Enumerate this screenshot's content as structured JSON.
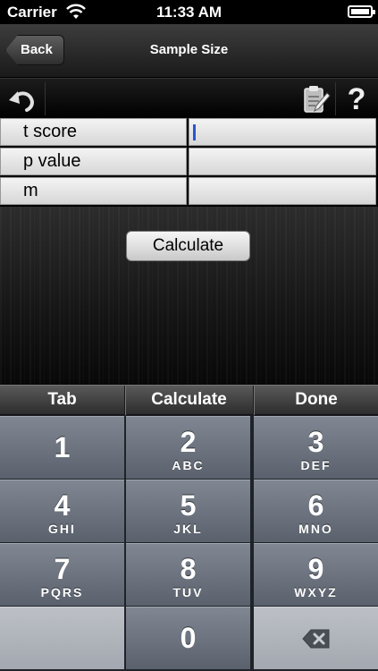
{
  "status_bar": {
    "carrier": "Carrier",
    "time": "11:33 AM"
  },
  "nav": {
    "back_label": "Back",
    "title": "Sample Size"
  },
  "toolbar": {
    "undo_icon": "undo-icon",
    "clipboard_icon": "clipboard-edit-icon",
    "help_label": "?"
  },
  "form": {
    "rows": [
      {
        "label": "t score",
        "value": ""
      },
      {
        "label": "p value",
        "value": ""
      },
      {
        "label": "m",
        "value": ""
      }
    ]
  },
  "calculate_label": "Calculate",
  "accessory": {
    "tab_label": "Tab",
    "calculate_label": "Calculate",
    "done_label": "Done"
  },
  "keypad": {
    "keys": [
      {
        "num": "1",
        "letters": ""
      },
      {
        "num": "2",
        "letters": "ABC"
      },
      {
        "num": "3",
        "letters": "DEF"
      },
      {
        "num": "4",
        "letters": "GHI"
      },
      {
        "num": "5",
        "letters": "JKL"
      },
      {
        "num": "6",
        "letters": "MNO"
      },
      {
        "num": "7",
        "letters": "PQRS"
      },
      {
        "num": "8",
        "letters": "TUV"
      },
      {
        "num": "9",
        "letters": "WXYZ"
      },
      {
        "num": "0",
        "letters": ""
      }
    ]
  },
  "colors": {
    "caret": "#2a55d8",
    "keypad_key": "#6b727d"
  }
}
